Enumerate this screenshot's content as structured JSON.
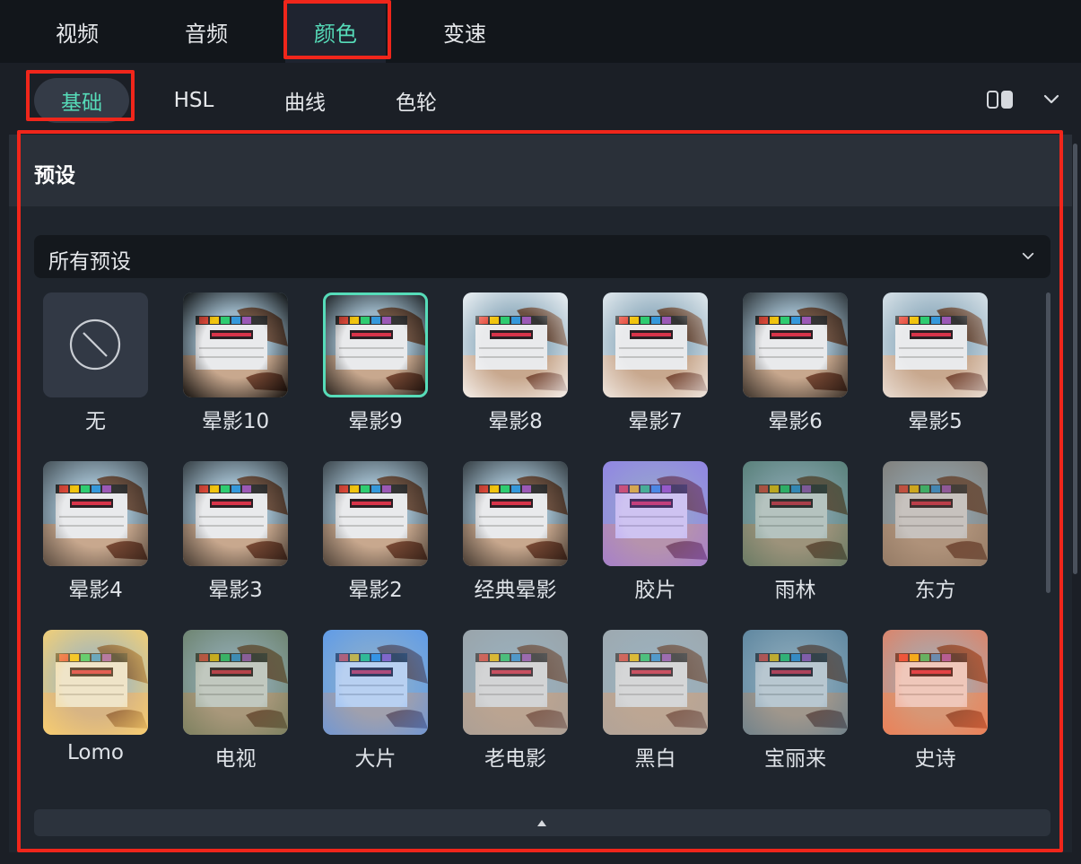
{
  "top_tabs": [
    {
      "label": "视频",
      "active": false
    },
    {
      "label": "音频",
      "active": false
    },
    {
      "label": "颜色",
      "active": true
    },
    {
      "label": "变速",
      "active": false
    }
  ],
  "sub_tabs": [
    {
      "label": "基础",
      "active": true
    },
    {
      "label": "HSL",
      "active": false
    },
    {
      "label": "曲线",
      "active": false
    },
    {
      "label": "色轮",
      "active": false
    }
  ],
  "toolbar_icons": [
    "compare-view-icon",
    "chevron-down-icon"
  ],
  "panel": {
    "title": "预设",
    "select_value": "所有预设",
    "selected_preset": "晕影9",
    "presets": [
      {
        "label": "无",
        "type": "none"
      },
      {
        "label": "晕影10",
        "tint": "#000000",
        "vignette": 0.55
      },
      {
        "label": "晕影9",
        "tint": "#000000",
        "vignette": 0.5
      },
      {
        "label": "晕影8",
        "tint": "#ffffff",
        "vignette": 0.45
      },
      {
        "label": "晕影7",
        "tint": "#ffffff",
        "vignette": 0.35
      },
      {
        "label": "晕影6",
        "tint": "#000000",
        "vignette": 0.35
      },
      {
        "label": "晕影5",
        "tint": "#ffffff",
        "vignette": 0.25
      },
      {
        "label": "晕影4",
        "tint": "#000000",
        "vignette": 0.2
      },
      {
        "label": "晕影3",
        "tint": "#000000",
        "vignette": 0.3
      },
      {
        "label": "晕影2",
        "tint": "#000000",
        "vignette": 0.25
      },
      {
        "label": "经典晕影",
        "tint": "#000000",
        "vignette": 0.3
      },
      {
        "label": "胶片",
        "tint": "#8a5cff",
        "vignette": 0.0
      },
      {
        "label": "雨林",
        "tint": "#2f5f4a",
        "vignette": 0.1
      },
      {
        "label": "东方",
        "tint": "#6e5a48",
        "vignette": 0.05
      },
      {
        "label": "Lomo",
        "tint": "#ffd36b",
        "vignette": 0.45
      },
      {
        "label": "电视",
        "tint": "#5a6e4a",
        "vignette": 0.2
      },
      {
        "label": "大片",
        "tint": "#3b8cff",
        "vignette": 0.1
      },
      {
        "label": "老电影",
        "tint": "#9a9a9a",
        "vignette": 0.1
      },
      {
        "label": "黑白",
        "tint": "#a0a0a0",
        "vignette": 0.05
      },
      {
        "label": "宝丽来",
        "tint": "#3a6a8a",
        "vignette": 0.1
      },
      {
        "label": "史诗",
        "tint": "#ff6a3a",
        "vignette": 0.15
      }
    ]
  },
  "colors": {
    "accent": "#56dcb9",
    "highlight": "#f0261b"
  }
}
